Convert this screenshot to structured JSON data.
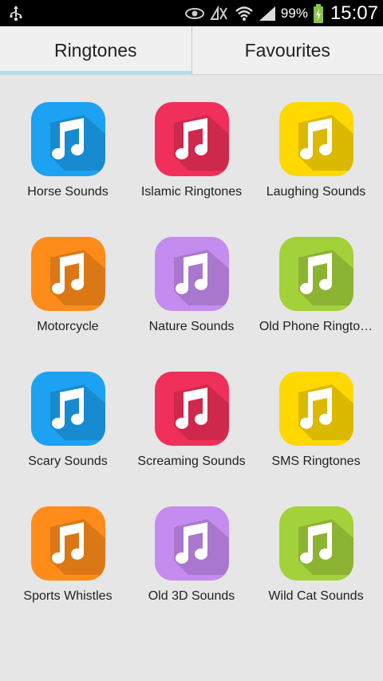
{
  "status_bar": {
    "battery_percent": "99%",
    "time": "15:07",
    "icons": [
      "usb-icon",
      "eye-icon",
      "no-signal-nfc-icon",
      "wifi-icon",
      "signal-icon",
      "battery-charging-icon"
    ]
  },
  "tabs": [
    {
      "label": "Ringtones",
      "active": true
    },
    {
      "label": "Favourites",
      "active": false
    }
  ],
  "categories": [
    {
      "label": "Horse Sounds",
      "color": "#1da1f2"
    },
    {
      "label": "Islamic Ringtones",
      "color": "#f0305a"
    },
    {
      "label": "Laughing Sounds",
      "color": "#ffd800"
    },
    {
      "label": "Motorcycle",
      "color": "#ff8c1a"
    },
    {
      "label": "Nature Sounds",
      "color": "#c58cf0"
    },
    {
      "label": "Old Phone Ringto…",
      "color": "#a3d13a"
    },
    {
      "label": "Scary Sounds",
      "color": "#1da1f2"
    },
    {
      "label": "Screaming Sounds",
      "color": "#f0305a"
    },
    {
      "label": "SMS Ringtones",
      "color": "#ffd800"
    },
    {
      "label": "Sports Whistles",
      "color": "#ff8c1a"
    },
    {
      "label": "Old 3D Sounds",
      "color": "#c58cf0"
    },
    {
      "label": "Wild Cat Sounds",
      "color": "#a3d13a"
    }
  ]
}
